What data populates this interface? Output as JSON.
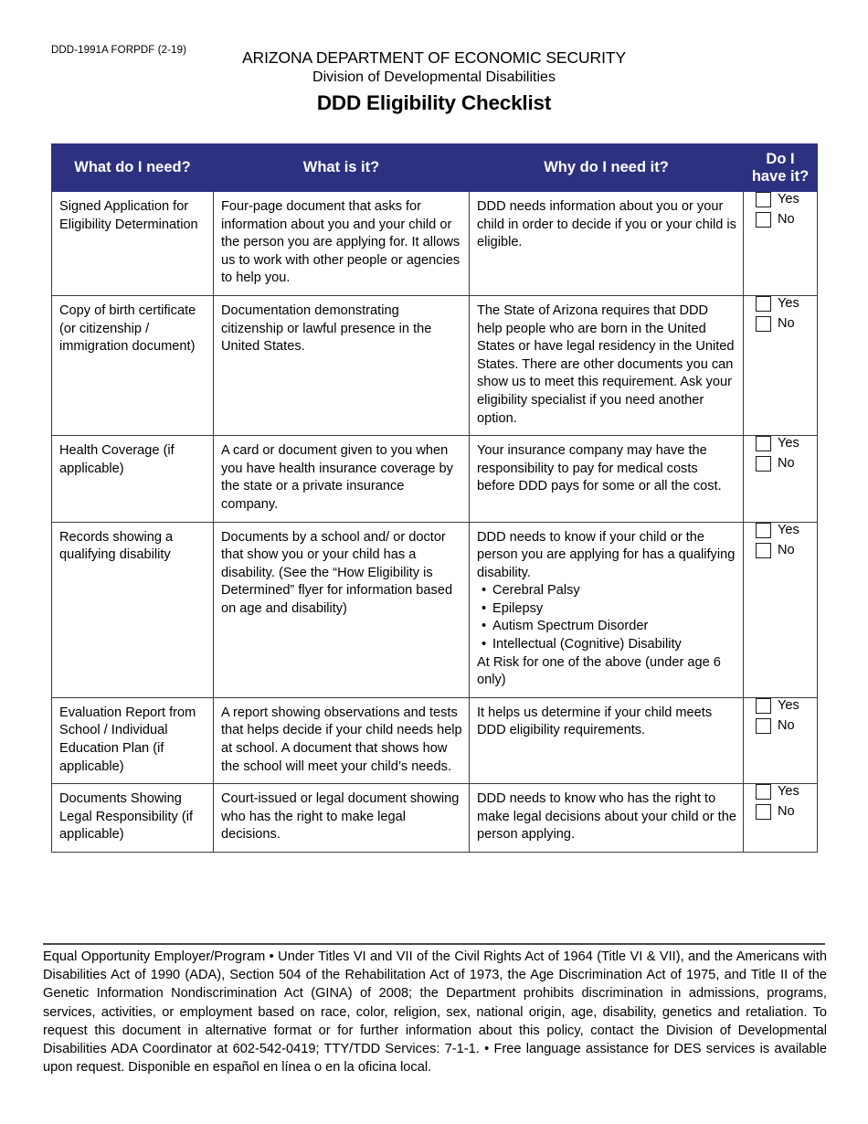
{
  "header": {
    "form_code": "DDD-1991A FORPDF (2-19)",
    "agency_name": "ARIZONA DEPARTMENT OF ECONOMIC SECURITY",
    "division_name": "Division of Developmental Disabilities",
    "doc_title": "DDD Eligibility Checklist"
  },
  "colors": {
    "header_navy": "#2e3180",
    "border": "#3b3b3b",
    "text": "#000000"
  },
  "table": {
    "columns": [
      {
        "label": "What do I need?"
      },
      {
        "label": "What is it?"
      },
      {
        "label": "Why do I need it?"
      },
      {
        "label": "Do I\nhave it?",
        "line1": "Do I",
        "line2": "have it?"
      }
    ],
    "checkbox_labels": {
      "yes": "Yes",
      "no": "No"
    },
    "rows": [
      {
        "need": "Signed Application for Eligibility Determination",
        "what": "Four-page document that asks for information about you and your child or the person you are applying for. It allows us to work with other people or agencies to help you.",
        "why": "DDD needs information about you or your child in order to decide if you or your child is eligible.",
        "why_bullets": [],
        "why_after": ""
      },
      {
        "need": "Copy of birth certificate (or citizenship / immigration document)",
        "what": "Documentation demonstrating citizenship or lawful presence in the United States.",
        "why": "The State of Arizona requires that DDD help people who are born in the United States or have legal residency in the United States. There are other documents you can show us to meet this requirement. Ask your eligibility specialist if you need another option.",
        "why_bullets": [],
        "why_after": ""
      },
      {
        "need": "Health Coverage (if applicable)",
        "what": "A card or document given to you when you have health insurance coverage by the state or a  private insurance company.",
        "why": "Your insurance company may have the responsibility to pay for medical costs before DDD pays for some or all the cost.",
        "why_bullets": [],
        "why_after": ""
      },
      {
        "need": "Records showing a qualifying disability",
        "what": "Documents by a school and/ or doctor that show you or your child has a disability. (See the “How Eligibility is Determined”  flyer for information based on age and disability)",
        "why": "DDD needs to know if your child or the person you are applying for has a qualifying disability.",
        "why_bullets": [
          "Cerebral Palsy",
          "Epilepsy",
          "Autism Spectrum Disorder",
          "Intellectual (Cognitive) Disability"
        ],
        "why_after": "At Risk for one of the above (under age 6 only)"
      },
      {
        "need": "Evaluation Report from School / Individual Education Plan (if applicable)",
        "what": "A report showing observations and tests that helps decide if your child needs help at school. A document that shows how the school will meet your child’s needs.",
        "why": "It helps us determine if your child meets DDD eligibility requirements.",
        "why_bullets": [],
        "why_after": ""
      },
      {
        "need": "Documents Showing Legal Responsibility (if applicable)",
        "what": "Court-issued or legal document showing who has the right to make legal decisions.",
        "why": "DDD needs to know who has the right to make legal decisions about your child or the person applying.",
        "why_bullets": [],
        "why_after": ""
      }
    ]
  },
  "footer": {
    "text": "Equal Opportunity Employer/Program • Under Titles VI and VII of the Civil Rights Act of 1964 (Title VI & VII), and the Americans with Disabilities Act of 1990 (ADA), Section 504 of the Rehabilitation Act of 1973, the Age Discrimination Act of 1975, and Title II of the Genetic Information Nondiscrimination Act (GINA) of 2008; the Department prohibits discrimination in admissions, programs, services, activities, or employment based on race, color, religion, sex, national origin, age, disability, genetics and retaliation. To request this document in alternative format or for further information about this policy, contact the Division of Developmental Disabilities ADA Coordinator at 602-542-0419; TTY/TDD Services: 7-1-1. • Free language assistance for DES services is available upon request. Disponible en español en línea o en la oficina local."
  }
}
